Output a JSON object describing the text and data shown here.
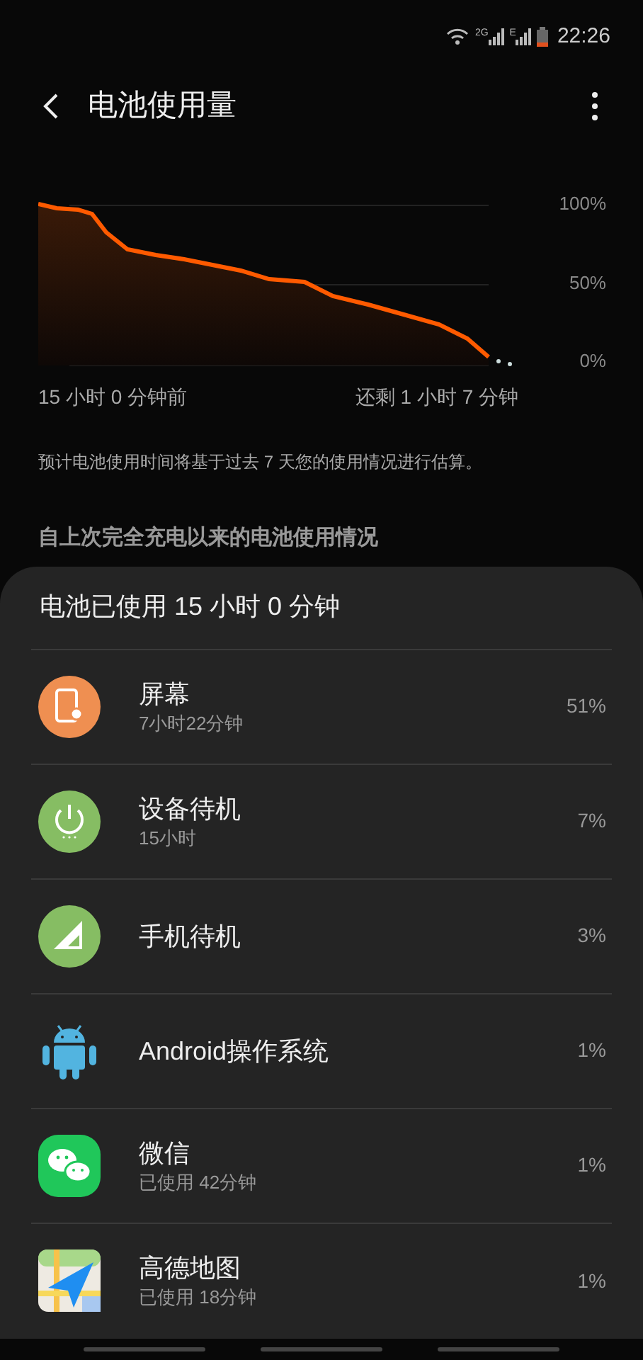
{
  "status_bar": {
    "time": "22:26",
    "network_labels": [
      "2G",
      "E"
    ]
  },
  "header": {
    "title": "电池使用量"
  },
  "chart": {
    "y_labels": [
      "100%",
      "50%",
      "0%"
    ],
    "start_label": "15 小时 0 分钟前",
    "end_label": "还剩 1 小时 7 分钟"
  },
  "note": "预计电池使用时间将基于过去 7 天您的使用情况进行估算。",
  "section_title": "自上次完全充电以来的电池使用情况",
  "sheet": {
    "title": "电池已使用 15 小时 0 分钟",
    "items": [
      {
        "kind": "screen",
        "name": "屏幕",
        "detail": "7小时22分钟",
        "percent": "51%"
      },
      {
        "kind": "standby",
        "name": "设备待机",
        "detail": "15小时",
        "percent": "7%"
      },
      {
        "kind": "phone",
        "name": "手机待机",
        "percent": "3%"
      },
      {
        "kind": "android",
        "name": "Android操作系统",
        "percent": "1%"
      },
      {
        "kind": "wechat",
        "name": "微信",
        "detail": "已使用 42分钟",
        "percent": "1%"
      },
      {
        "kind": "map",
        "name": "高德地图",
        "detail": "已使用 18分钟",
        "percent": "1%"
      }
    ]
  }
}
